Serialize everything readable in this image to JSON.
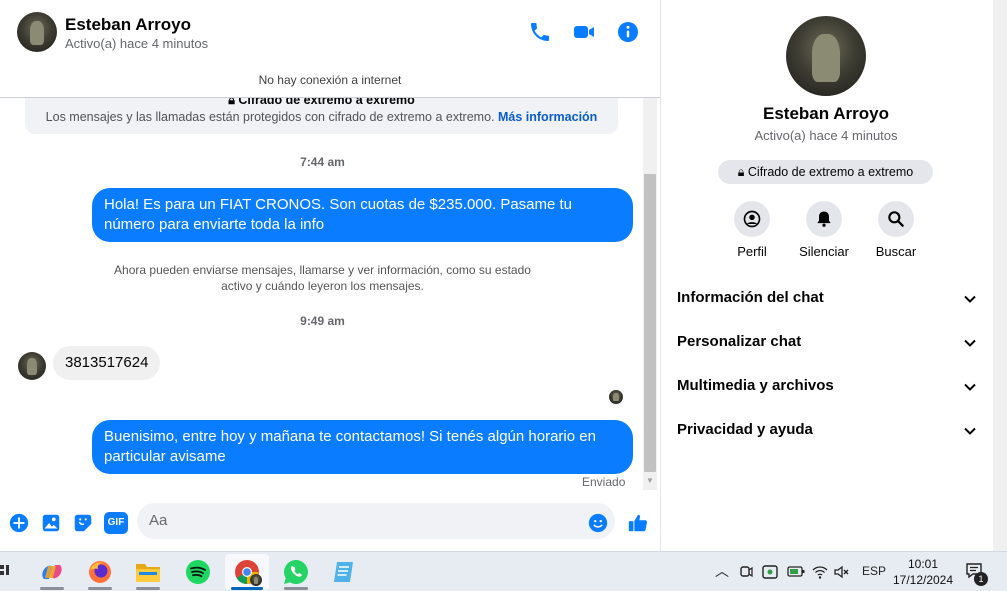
{
  "header": {
    "name": "Esteban Arroyo",
    "status": "Activo(a) hace 4 minutos"
  },
  "banner": "No hay conexión a internet",
  "e2e": {
    "title": "Cifrado de extremo a extremo",
    "text": "Los mensajes y las llamadas están protegidos con cifrado de extremo a extremo.",
    "link": "Más información"
  },
  "messages": {
    "time1": "7:44 am",
    "out1": "Hola! Es para un FIAT CRONOS. Son cuotas de $235.000. Pasame tu número para enviarte toda la info",
    "system": "Ahora pueden enviarse mensajes, llamarse y ver información, como su estado activo y cuándo leyeron los mensajes.",
    "time2": "9:49 am",
    "in1": "3813517624",
    "out2": "Buenisimo, entre hoy y mañana te contactamos! Si tenés algún horario en particular avisame",
    "sent_status": "Enviado"
  },
  "composer": {
    "placeholder": "Aa"
  },
  "panel": {
    "name": "Esteban Arroyo",
    "status": "Activo(a) hace 4 minutos",
    "badge": "Cifrado de extremo a extremo",
    "actions": [
      {
        "label": "Perfil"
      },
      {
        "label": "Silenciar"
      },
      {
        "label": "Buscar"
      }
    ],
    "sections": [
      {
        "label": "Información del chat"
      },
      {
        "label": "Personalizar chat"
      },
      {
        "label": "Multimedia y archivos"
      },
      {
        "label": "Privacidad y ayuda"
      }
    ]
  },
  "taskbar": {
    "lang": "ESP",
    "time": "10:01",
    "date": "17/12/2024",
    "notifications": "1"
  },
  "colors": {
    "accent": "#0a7cff",
    "link": "#0a5ccf",
    "incoming": "#f0f0f0",
    "panel_badge": "#e4e6eb"
  }
}
